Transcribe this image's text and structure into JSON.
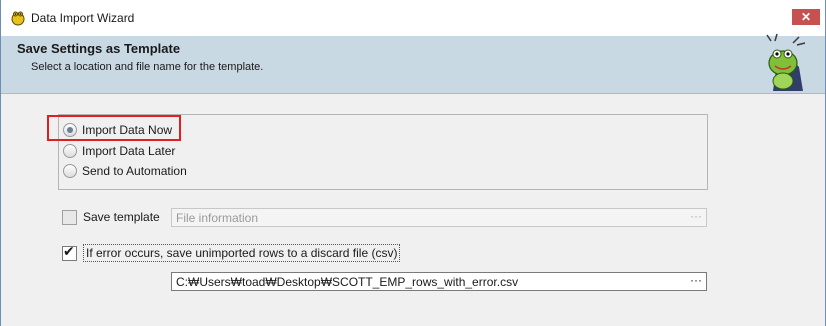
{
  "window": {
    "title": "Data Import Wizard",
    "close_glyph": "✕"
  },
  "header": {
    "title": "Save Settings as Template",
    "subtitle": "Select a location and file name for the template."
  },
  "import_mode": {
    "options": [
      {
        "label": "Import Data Now",
        "selected": true
      },
      {
        "label": "Import Data Later",
        "selected": false
      },
      {
        "label": "Send to Automation",
        "selected": false
      }
    ]
  },
  "save_template": {
    "label": "Save template",
    "checked": false,
    "field_placeholder": "File information",
    "browse_glyph": "···"
  },
  "error_handling": {
    "label": "If error occurs, save unimported rows to a discard file (csv)",
    "checked": true,
    "path": "C:₩Users₩toad₩Desktop₩SCOTT_EMP_rows_with_error.csv",
    "browse_glyph": "···"
  },
  "colors": {
    "header_bg": "#c9d9e4",
    "highlight": "#e02020",
    "close_bg": "#c75050"
  },
  "icons": {
    "app": "toad-icon",
    "mascot": "toad-mascot-icon"
  }
}
